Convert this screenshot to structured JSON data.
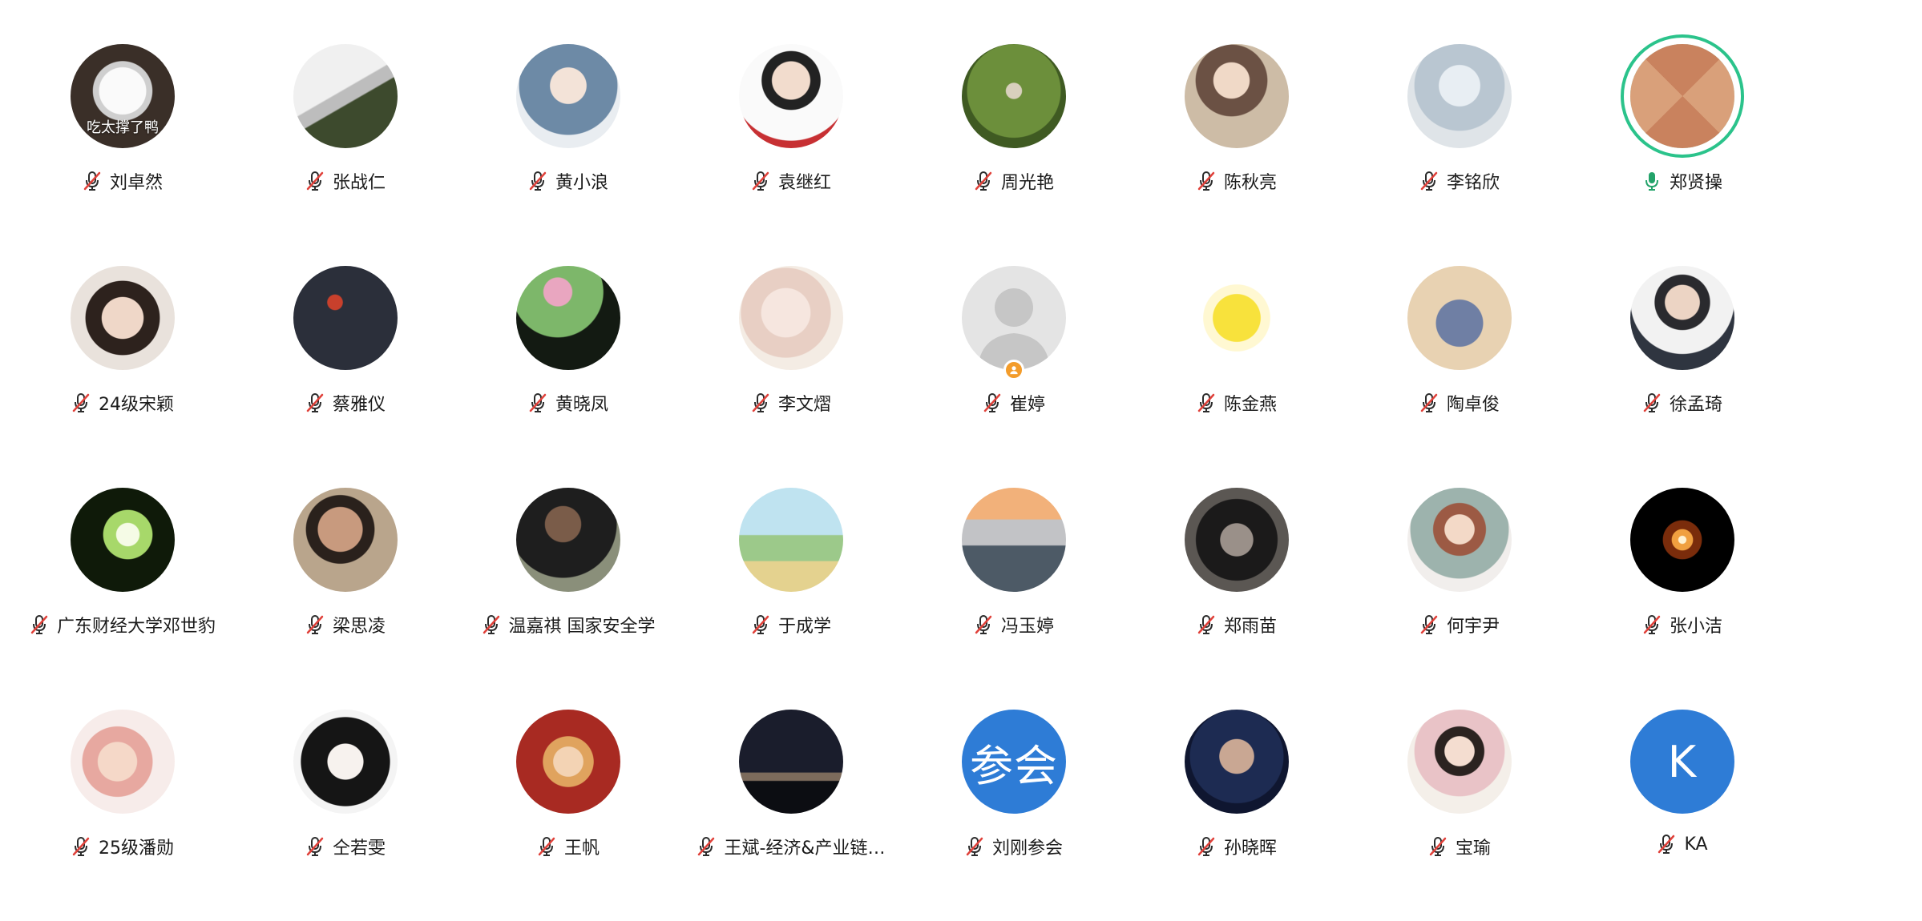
{
  "participants": [
    {
      "name": "刘卓然",
      "mic": "muted",
      "avatar": {
        "kind": "photo",
        "bg": "radial-gradient(circle at 50% 45%, #fafafa 0 30%, #cfcfcf 31% 38%, #3a2f28 39% 100%)",
        "overlay_text": "吃太撑了鸭"
      }
    },
    {
      "name": "张战仁",
      "mic": "muted",
      "avatar": {
        "kind": "photo",
        "bg": "linear-gradient(150deg, #f0f0f0 0 45%, #bdbdbd 46% 55%, #3d4a2d 56% 100%)"
      }
    },
    {
      "name": "黄小浪",
      "mic": "muted",
      "avatar": {
        "kind": "photo",
        "bg": "radial-gradient(circle at 50% 40%, #f3e3d8 0 22%, #6d8aa6 23% 60%, #e9edf1 61% 100%)"
      }
    },
    {
      "name": "袁继红",
      "mic": "muted",
      "avatar": {
        "kind": "photo",
        "bg": "radial-gradient(circle at 50% 35%, #f2dccd 0 22%, #222 23% 34%, #fafafa 35% 70%, #c73033 71% 100%)"
      }
    },
    {
      "name": "周光艳",
      "mic": "muted",
      "avatar": {
        "kind": "photo",
        "bg": "radial-gradient(circle at 50% 45%, #d8d0bd 0 10%, #6c8f3b 11% 60%, #3f5a22 61% 100%)"
      }
    },
    {
      "name": "陈秋亮",
      "mic": "muted",
      "avatar": {
        "kind": "photo",
        "bg": "radial-gradient(circle at 45% 35%, #f0d9c7 0 20%, #6b5144 21% 40%, #cdbca6 41% 100%)"
      }
    },
    {
      "name": "李铭欣",
      "mic": "muted",
      "avatar": {
        "kind": "photo",
        "bg": "radial-gradient(circle at 50% 40%, #e8eef3 0 25%, #b9c6d1 26% 55%, #dfe4e8 56% 100%)"
      }
    },
    {
      "name": "郑贤操",
      "mic": "active",
      "speaking": true,
      "avatar": {
        "kind": "photo",
        "bg": "conic-gradient(from 45deg, #d9a07a 0 25%, #c9825e 25% 50%, #d9a07a 50% 75%, #c9825e 75% 100%)"
      }
    },
    {
      "name": "24级宋颖",
      "mic": "muted",
      "avatar": {
        "kind": "photo",
        "bg": "radial-gradient(circle at 50% 50%, #efd7c8 0 28%, #2d221d 29% 50%, #e9e2dc 51% 100%)"
      }
    },
    {
      "name": "蔡雅仪",
      "mic": "muted",
      "avatar": {
        "kind": "photo",
        "bg": "radial-gradient(circle at 40% 35%, #c8402c 0 8%, #2b2f3a 9% 100%)"
      }
    },
    {
      "name": "黄晓凤",
      "mic": "muted",
      "avatar": {
        "kind": "photo",
        "bg": "radial-gradient(circle at 40% 25%, #e9a6c0 0 14%, #7db76a 15% 45%, #131a12 46% 100%)"
      }
    },
    {
      "name": "李文熠",
      "mic": "muted",
      "avatar": {
        "kind": "photo",
        "bg": "radial-gradient(circle at 45% 45%, #f6e6df 0 30%, #e8cfc4 31% 55%, #f4ece4 56% 100%)"
      }
    },
    {
      "name": "崔婷",
      "mic": "muted",
      "host": true,
      "avatar": {
        "kind": "default",
        "bg": "#e4e4e4"
      }
    },
    {
      "name": "陈金燕",
      "mic": "muted",
      "avatar": {
        "kind": "photo",
        "bg": "radial-gradient(circle at 50% 50%, #f8e23c 0 32%, #fff8d2 33% 45%, #ffffff 46% 100%)"
      }
    },
    {
      "name": "陶卓俊",
      "mic": "muted",
      "avatar": {
        "kind": "photo",
        "bg": "radial-gradient(circle at 50% 55%, #6f7fa4 0 30%, #e8d2b2 31% 100%)"
      }
    },
    {
      "name": "徐孟琦",
      "mic": "muted",
      "avatar": {
        "kind": "photo",
        "bg": "radial-gradient(circle at 50% 35%, #ecd4c4 0 20%, #2a2a2e 21% 32%, #f2f2f2 33% 60%, #2f3540 61% 100%)"
      }
    },
    {
      "name": "广东财经大学邓世豹",
      "mic": "muted",
      "avatar": {
        "kind": "photo",
        "bg": "radial-gradient(circle at 55% 45%, #f5fbe6 0 14%, #a7d86a 15% 30%, #0f1a09 31% 100%)"
      }
    },
    {
      "name": "梁思凌",
      "mic": "muted",
      "avatar": {
        "kind": "photo",
        "bg": "radial-gradient(circle at 45% 40%, #c89a7e 0 26%, #2a211c 27% 40%, #b9a58c 41% 100%)"
      }
    },
    {
      "name": "温嘉祺 国家安全学",
      "mic": "muted",
      "avatar": {
        "kind": "photo",
        "bg": "radial-gradient(circle at 45% 35%, #7a5c49 0 20%, #1e1e1e 21% 60%, #8a8f7a 61% 100%)"
      }
    },
    {
      "name": "于成学",
      "mic": "muted",
      "avatar": {
        "kind": "photo",
        "bg": "linear-gradient(180deg, #bfe3f0 0 45%, #9cc98a 46% 70%, #e4d28f 71% 100%)"
      }
    },
    {
      "name": "冯玉婷",
      "mic": "muted",
      "avatar": {
        "kind": "photo",
        "bg": "linear-gradient(180deg, #f2b17a 0 30%, #c2c3c6 31% 55%, #4d5a66 56% 100%)"
      }
    },
    {
      "name": "郑雨苗",
      "mic": "muted",
      "avatar": {
        "kind": "photo",
        "bg": "radial-gradient(circle at 50% 50%, #9a9089 0 22%, #1b1a1a 23% 55%, #5b5753 56% 100%)"
      }
    },
    {
      "name": "何宇尹",
      "mic": "muted",
      "avatar": {
        "kind": "photo",
        "bg": "radial-gradient(circle at 50% 40%, #f3d9c7 0 18%, #9c5a44 19% 32%, #9db3ad 33% 60%, #f1eeec 61% 100%)"
      }
    },
    {
      "name": "张小洁",
      "mic": "muted",
      "avatar": {
        "kind": "photo",
        "bg": "radial-gradient(circle at 50% 50%, #fff3d4 0 5%, #f0a040 6% 14%, #7a2c0b 15% 26%, #000000 27% 100%)"
      }
    },
    {
      "name": "25级潘勋",
      "mic": "muted",
      "avatar": {
        "kind": "photo",
        "bg": "radial-gradient(circle at 45% 50%, #f5d8c8 0 25%, #e7a8a0 26% 45%, #f7ecea 46% 100%)"
      }
    },
    {
      "name": "仝若雯",
      "mic": "muted",
      "avatar": {
        "kind": "photo",
        "bg": "radial-gradient(circle at 50% 50%, #f7f2ee 0 24%, #151515 25% 60%, #f4f4f4 61% 100%)"
      }
    },
    {
      "name": "王帆",
      "mic": "muted",
      "avatar": {
        "kind": "photo",
        "bg": "radial-gradient(circle at 50% 50%, #f3d3b4 0 20%, #e0a35e 21% 34%, #a82a22 35% 100%)"
      }
    },
    {
      "name": "王斌-经济&产业链…",
      "mic": "muted",
      "avatar": {
        "kind": "photo",
        "bg": "linear-gradient(180deg, #1a1d2c 0 60%, #7c6b5c 61% 68%, #0c0d12 69% 100%)"
      }
    },
    {
      "name": "刘刚参会",
      "mic": "muted",
      "avatar": {
        "kind": "text",
        "bg": "#2e7cd6",
        "initial": "参会"
      }
    },
    {
      "name": "孙晓晖",
      "mic": "muted",
      "avatar": {
        "kind": "photo",
        "bg": "radial-gradient(circle at 50% 45%, #c9a793 0 22%, #1d2b52 23% 60%, #0f1630 61% 100%)"
      }
    },
    {
      "name": "宝瑜",
      "mic": "muted",
      "avatar": {
        "kind": "photo",
        "bg": "radial-gradient(circle at 50% 40%, #f4ddd0 0 18%, #2b2320 19% 30%, #e9c3c7 31% 55%, #f4efe9 56% 100%)"
      }
    },
    {
      "name": "KA",
      "mic": "muted",
      "avatar": {
        "kind": "text",
        "bg": "#2e7cd6",
        "initial": "K"
      }
    }
  ],
  "colors": {
    "speaking_ring": "#2bc38b",
    "mic_active": "#23a36a",
    "mic_muted": "#2b2b2b",
    "mic_slash": "#e0413a",
    "host_badge": "#f39c2b",
    "default_avatar_silhouette": "#c6c6c6"
  },
  "icons": {
    "mic_muted": "mic-muted-icon",
    "mic_active": "mic-active-icon",
    "host": "host-badge-icon",
    "default_avatar": "person-silhouette-icon"
  }
}
